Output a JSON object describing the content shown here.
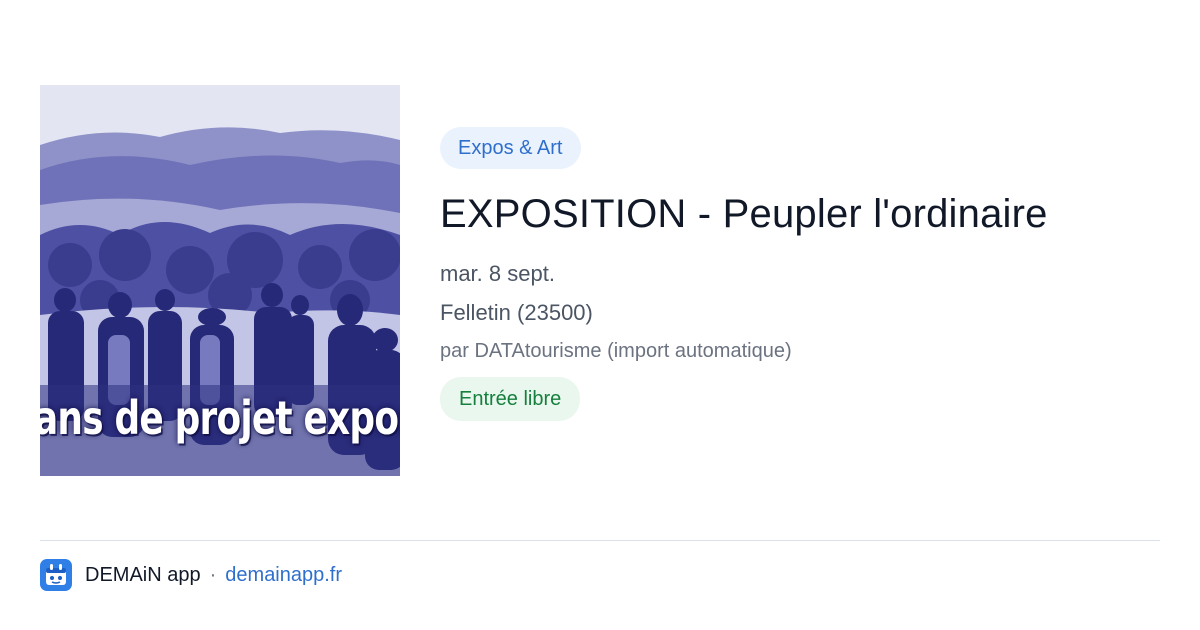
{
  "event": {
    "image": {
      "alt": "photo-paysage",
      "overlay_text": "ans de projet expos"
    },
    "category": "Expos & Art",
    "title": "EXPOSITION - Peupler l'ordinaire",
    "date": "mar. 8 sept.",
    "location": "Felletin (23500)",
    "author": "par DATAtourisme (import automatique)",
    "price": "Entrée libre"
  },
  "footer": {
    "app_icon": "app-logo-icon",
    "app_name": "DEMAiN app",
    "separator": "·",
    "link": "demainapp.fr"
  },
  "colors": {
    "accent": "#2f6fcc",
    "category_bg": "#eaf2fd",
    "price_bg": "#eaf7ee",
    "price_text": "#15803d",
    "image_tint": "#3a3c9a"
  }
}
